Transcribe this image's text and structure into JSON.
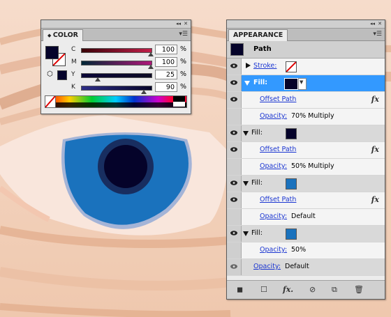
{
  "artwork": {
    "description_colors": {
      "skin": "#f1cfb8",
      "iris": "#1a72bd",
      "pupil": "#05032a"
    }
  },
  "color_panel": {
    "tab": "COLOR",
    "sliders": [
      {
        "label": "C",
        "value": "100",
        "unit": "%",
        "color": "#c21f4a"
      },
      {
        "label": "M",
        "value": "100",
        "unit": "%",
        "color": "#b0177a"
      },
      {
        "label": "Y",
        "value": "25",
        "unit": "%",
        "color": "#2e2e88"
      },
      {
        "label": "K",
        "value": "90",
        "unit": "%",
        "color": "#1a1a60"
      }
    ]
  },
  "appearance_panel": {
    "tab": "APPEARANCE",
    "header_title": "Path",
    "stroke_label": "Stroke:",
    "rows": {
      "fill1_label": "Fill:",
      "fill1_color": "#05032a",
      "offset1": "Offset Path",
      "opacity1_label": "Opacity:",
      "opacity1_value": "70% Multiply",
      "fill2_label": "Fill:",
      "fill2_color": "#05032a",
      "offset2": "Offset Path",
      "opacity2_label": "Opacity:",
      "opacity2_value": "50% Multiply",
      "fill3_label": "Fill:",
      "fill3_color": "#1a72bd",
      "offset3": "Offset Path",
      "opacity3_label": "Opacity:",
      "opacity3_value": "Default",
      "fill4_label": "Fill:",
      "fill4_color": "#1a72bd",
      "opacity4_label": "Opacity:",
      "opacity4_value": "50%",
      "opacity_main_label": "Opacity:",
      "opacity_main_value": "Default"
    },
    "fx_symbol": "fx"
  }
}
